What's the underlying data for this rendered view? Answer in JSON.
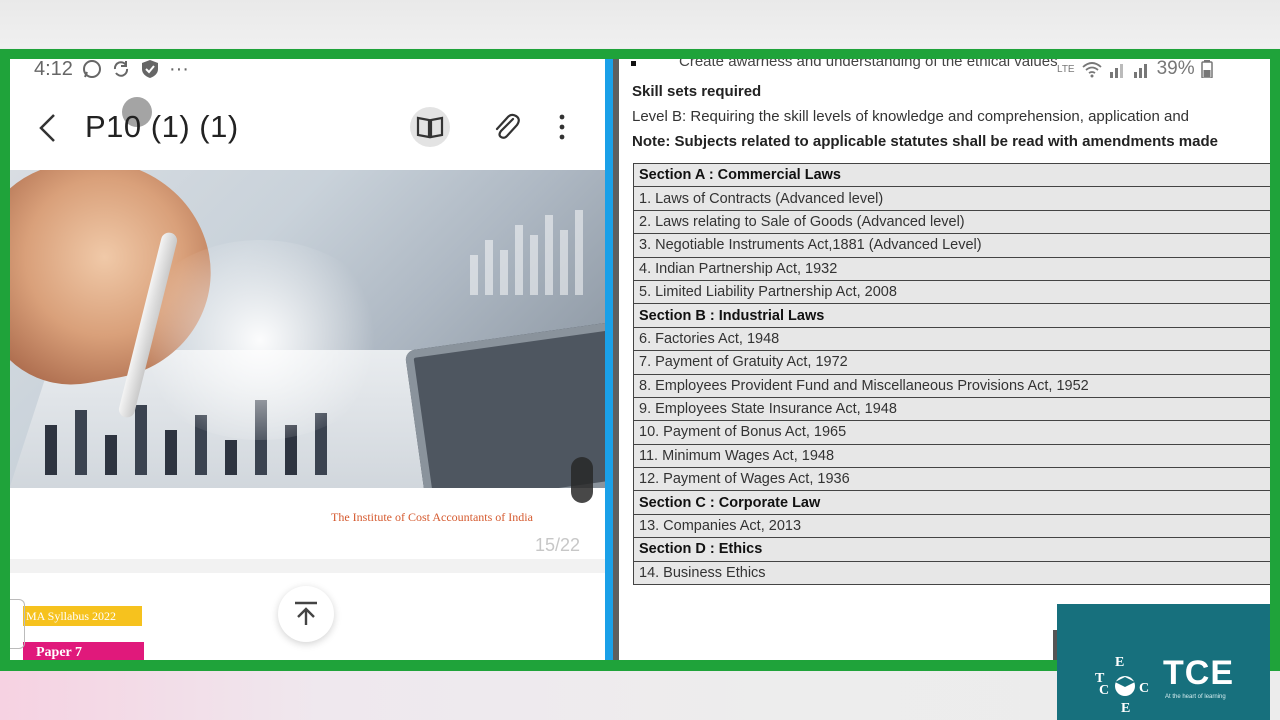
{
  "left_pane": {
    "status": {
      "time": "4:12",
      "overflow": "···"
    },
    "header": {
      "title": "P10 (1) (1)"
    },
    "page": {
      "institute": "The Institute of Cost Accountants of India",
      "counter": "15/22"
    },
    "next_page": {
      "syllabus_tag": "MA Syllabus 2022",
      "paper_tag": "Paper 7"
    }
  },
  "right_pane": {
    "truncated_line": "Create awarness and understanding of the ethical values",
    "status": {
      "network": "LTE",
      "battery": "39%"
    },
    "skill_heading": "Skill sets required",
    "level_b": "Level B: Requiring the skill levels of knowledge and comprehension, application and",
    "note": "Note: Subjects related to applicable statutes shall be read with amendments made",
    "table_rows": [
      {
        "text": "Section A : Commercial Laws",
        "section": true
      },
      {
        "text": "1. Laws of Contracts (Advanced level)",
        "section": false
      },
      {
        "text": "2. Laws relating to Sale of Goods (Advanced level)",
        "section": false
      },
      {
        "text": "3. Negotiable Instruments Act,1881 (Advanced Level)",
        "section": false
      },
      {
        "text": "4. Indian Partnership Act, 1932",
        "section": false
      },
      {
        "text": "5. Limited Liability Partnership Act, 2008",
        "section": false
      },
      {
        "text": "Section B : Industrial Laws",
        "section": true
      },
      {
        "text": "6. Factories Act, 1948",
        "section": false
      },
      {
        "text": "7. Payment of Gratuity Act, 1972",
        "section": false
      },
      {
        "text": "8. Employees Provident Fund and Miscellaneous  Provisions Act, 1952",
        "section": false
      },
      {
        "text": "9. Employees State Insurance Act, 1948",
        "section": false
      },
      {
        "text": "10. Payment of Bonus Act, 1965",
        "section": false
      },
      {
        "text": "11. Minimum Wages Act, 1948",
        "section": false
      },
      {
        "text": "12. Payment of Wages Act, 1936",
        "section": false
      },
      {
        "text": "Section C : Corporate Law",
        "section": true
      },
      {
        "text": "13. Companies Act, 2013",
        "section": false
      },
      {
        "text": "Section D : Ethics",
        "section": true
      },
      {
        "text": "14. Business Ethics",
        "section": false
      }
    ]
  },
  "watermark": {
    "brand": "TCE",
    "emblem_letters": [
      "C",
      "E",
      "T",
      "C",
      "E"
    ],
    "tagline": "At the heart of learning",
    "color": "#17707d"
  },
  "colors": {
    "frame": "#1fa33a",
    "divider": "#1aa0e8",
    "accent_orange": "#d55a2f",
    "tag_yellow": "#f6c21e",
    "tag_pink": "#e0197b"
  }
}
